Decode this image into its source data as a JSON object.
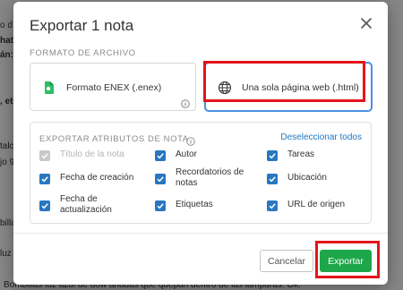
{
  "background": {
    "lines": [
      {
        "text": "o d",
        "bold": false
      },
      {
        "text": "hat",
        "bold": true
      },
      {
        "text": "án:",
        "bold": true
      },
      {
        "text": ", etc",
        "bold": true
      },
      {
        "text": "talc",
        "bold": false
      },
      {
        "text": "jo 9",
        "bold": false
      },
      {
        "text": "billa",
        "bold": false
      },
      {
        "text": "luz a",
        "bold": false
      },
      {
        "text": "Bombillas luz azul de dow añadas que quepan dentro de las lámparas. Ok.",
        "bold": false
      }
    ]
  },
  "modal": {
    "title": "Exportar 1 nota",
    "close_icon": "close-icon",
    "format_section_label": "FORMATO DE ARCHIVO",
    "formats": [
      {
        "label": "Formato ENEX (.enex)",
        "icon": "evernote-elephant-icon",
        "selected": false
      },
      {
        "label": "Una sola página web (.html)",
        "icon": "globe-icon",
        "selected": true
      }
    ],
    "attributes_section_label": "EXPORTAR ATRIBUTOS DE NOTA",
    "deselect_all_label": "Deseleccionar todos",
    "attributes": [
      {
        "label": "Título de la nota",
        "checked": true,
        "disabled": true
      },
      {
        "label": "Autor",
        "checked": true,
        "disabled": false
      },
      {
        "label": "Tareas",
        "checked": true,
        "disabled": false
      },
      {
        "label": "Fecha de creación",
        "checked": true,
        "disabled": false
      },
      {
        "label": "Recordatorios de\nnotas",
        "checked": true,
        "disabled": false
      },
      {
        "label": "Ubicación",
        "checked": true,
        "disabled": false
      },
      {
        "label": "Fecha de\nactualización",
        "checked": true,
        "disabled": false
      },
      {
        "label": "Etiquetas",
        "checked": true,
        "disabled": false
      },
      {
        "label": "URL de origen",
        "checked": true,
        "disabled": false
      }
    ],
    "cancel_label": "Cancelar",
    "export_label": "Exportar"
  },
  "colors": {
    "accent_blue": "#2877c0",
    "export_green": "#1ea74a",
    "highlight_red": "#e3141b",
    "link_blue": "#2077c4"
  }
}
